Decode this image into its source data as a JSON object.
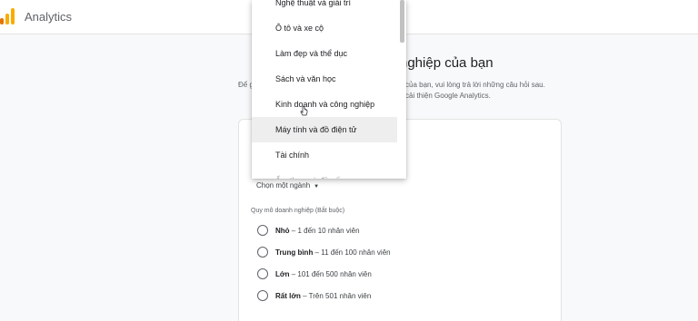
{
  "app": {
    "title": "Analytics"
  },
  "page": {
    "heading": "nghiệp của bạn",
    "intro_left": "Để g",
    "intro_line1": "của bạn, vui lòng trả lời những câu hỏi sau.",
    "intro_line2": "cải thiện Google Analytics."
  },
  "industry": {
    "selected": "Chọn một ngành"
  },
  "business_size": {
    "label": "Quy mô doanh nghiệp (Bắt buộc)",
    "options": [
      {
        "name": "Nhỏ",
        "detail": " – 1 đến 10 nhân viên"
      },
      {
        "name": "Trung bình",
        "detail": " – 11 đến 100 nhân viên"
      },
      {
        "name": "Lớn",
        "detail": " – 101 đến 500 nhân viên"
      },
      {
        "name": "Rất lớn",
        "detail": " – Trên 501 nhân viên"
      }
    ]
  },
  "dropdown": {
    "items": [
      "Nghệ thuật và giải trí",
      "Ô tô và xe cộ",
      "Làm đẹp và thể dục",
      "Sách và văn học",
      "Kinh doanh và công nghiệp",
      "Máy tính và đồ điện tử",
      "Tài chính",
      "Ẩm thực và đồ uống"
    ],
    "highlighted_index": 5
  },
  "colors": {
    "logo_orange": "#f9ab00",
    "logo_dark_orange": "#e37400",
    "highlight_bg": "#eeeeee"
  }
}
